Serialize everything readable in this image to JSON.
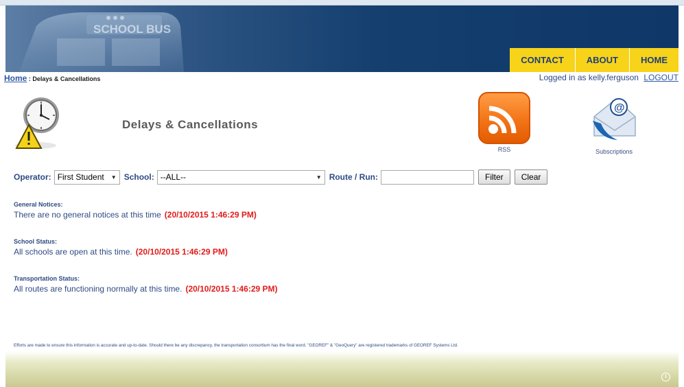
{
  "header": {
    "banner_text": "SCHOOL BUS",
    "nav": [
      "CONTACT",
      "ABOUT",
      "HOME"
    ]
  },
  "breadcrumb": {
    "home": "Home",
    "separator": " : ",
    "current": "Delays & Cancellations"
  },
  "user": {
    "logged_in_text": "Logged in as kelly.ferguson",
    "logout": "LOGOUT"
  },
  "page": {
    "title": "Delays & Cancellations"
  },
  "icons": {
    "clock": "alarm-clock-warning-icon",
    "rss": "rss-icon",
    "subscriptions": "email-subscription-icon"
  },
  "links": {
    "rss_label": "RSS",
    "subscriptions_label": "Subscriptions"
  },
  "filters": {
    "operator_label": "Operator:",
    "operator_value": "First Student",
    "school_label": "School:",
    "school_value": "--ALL--",
    "route_label": "Route / Run:",
    "route_value": "",
    "filter_button": "Filter",
    "clear_button": "Clear"
  },
  "sections": {
    "general": {
      "heading": "General Notices:",
      "text": "There are no general notices at this time",
      "timestamp": "(20/10/2015 1:46:29 PM)"
    },
    "school": {
      "heading": "School Status:",
      "text": "All schools are open at this time.",
      "timestamp": "(20/10/2015 1:46:29 PM)"
    },
    "transport": {
      "heading": "Transportation Status:",
      "text": "All routes are functioning normally at this time.",
      "timestamp": "(20/10/2015 1:46:29 PM)"
    }
  },
  "footer": {
    "disclaimer": "Efforts are made to ensure this information is accurate and up-to-date. Should there be any discrepancy, the transportation consortium has the final word. \"GEOREF\" & \"GeoQuery\" are registered trademarks of GEOREF Systems Ltd."
  },
  "colors": {
    "nav_bg": "#f7d31a",
    "nav_text": "#1f3f77",
    "banner": "#143f6f",
    "accent_text": "#2e4a82",
    "timestamp": "#e11b1b",
    "rss": "#f37417"
  }
}
